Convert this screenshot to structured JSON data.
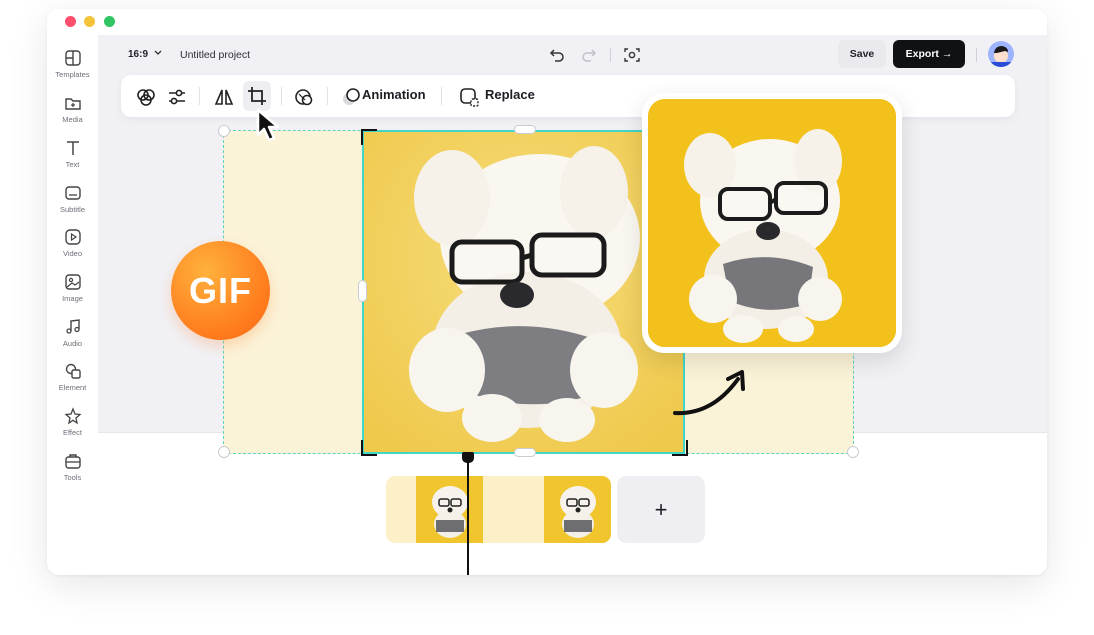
{
  "window": {
    "traffic_lights": [
      "#ff5f57",
      "#febc2e",
      "#28c840"
    ]
  },
  "sidebar": {
    "items": [
      {
        "label": "Templates",
        "icon": "templates-icon"
      },
      {
        "label": "Media",
        "icon": "media-icon"
      },
      {
        "label": "Text",
        "icon": "text-icon"
      },
      {
        "label": "Subtitle",
        "icon": "subtitle-icon"
      },
      {
        "label": "Video",
        "icon": "video-icon"
      },
      {
        "label": "Image",
        "icon": "image-icon"
      },
      {
        "label": "Audio",
        "icon": "audio-icon"
      },
      {
        "label": "Element",
        "icon": "element-icon"
      },
      {
        "label": "Effect",
        "icon": "effect-icon"
      },
      {
        "label": "Tools",
        "icon": "tools-icon"
      }
    ]
  },
  "header": {
    "aspect_ratio": "16:9",
    "project_title": "Untitled project",
    "save_label": "Save",
    "export_label": "Export"
  },
  "toolbar": {
    "tools": [
      "filters-icon",
      "adjust-icon",
      "flip-icon",
      "crop-icon",
      "mask-icon"
    ],
    "animation_label": "Animation",
    "replace_label": "Replace"
  },
  "canvas": {
    "badge_text": "GIF"
  },
  "timeline": {
    "add_label": "+"
  },
  "colors": {
    "accent_teal": "#41d6c9",
    "export_bg": "#101114",
    "badge_orange": "#ff7a1c",
    "photo_yellow": "#f3d462"
  }
}
